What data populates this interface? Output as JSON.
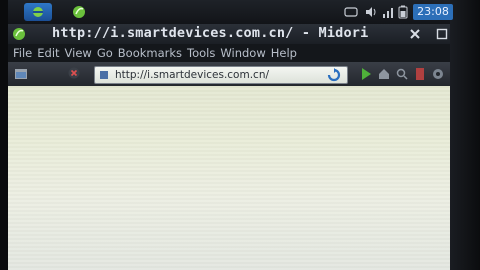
{
  "panel": {
    "clock": "23:08"
  },
  "window": {
    "title": "http://i.smartdevices.com.cn/ - Midori"
  },
  "menubar": {
    "items": [
      "File",
      "Edit",
      "View",
      "Go",
      "Bookmarks",
      "Tools",
      "Window",
      "Help"
    ]
  },
  "toolbar": {
    "url": "http://i.smartdevices.com.cn/"
  },
  "colors": {
    "panel_accent": "#2c6fb8",
    "page_background": "#e9ecd8"
  }
}
